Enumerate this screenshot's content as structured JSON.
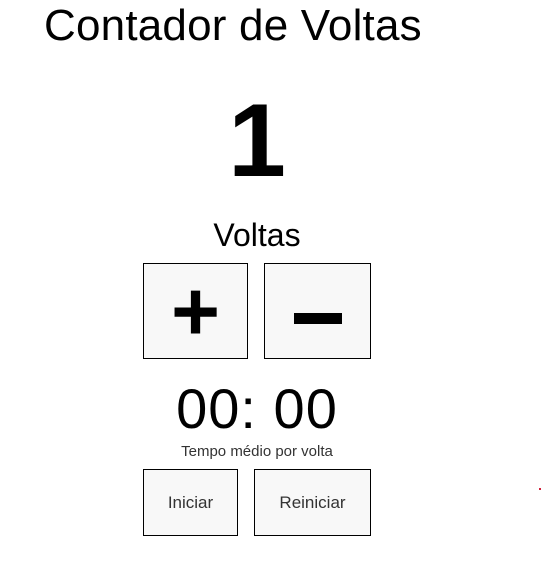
{
  "app": {
    "title": "Contador de Voltas"
  },
  "counter": {
    "value": "1",
    "label": "Voltas"
  },
  "controls": {
    "increment_label": "+",
    "decrement_label": "−"
  },
  "timer": {
    "value": "00: 00",
    "label": "Tempo médio por volta"
  },
  "actions": {
    "start_label": "Iniciar",
    "restart_label": "Reiniciar"
  },
  "colors": {
    "background": "#ffffff",
    "text": "#000000",
    "button_background": "#f8f8f8",
    "button_border": "#000000",
    "secondary_text": "#333333"
  }
}
